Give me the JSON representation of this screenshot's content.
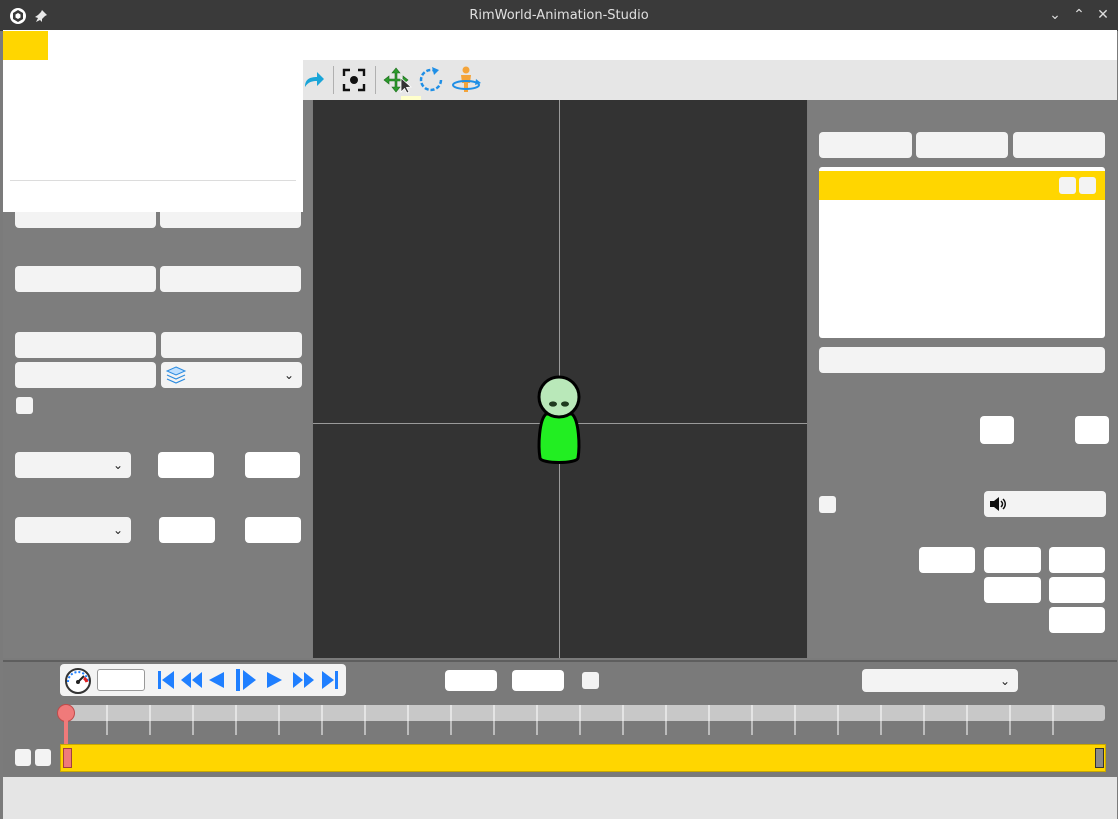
{
  "window": {
    "title": "RimWorld-Animation-Studio",
    "controls": [
      "minimize",
      "maximize",
      "close"
    ]
  },
  "toolbar": {
    "tools": [
      "redo",
      "center-view",
      "move",
      "rotate",
      "pose-rotate"
    ],
    "tooltip": ""
  },
  "left_panel": {
    "layer_dropdown_icon": "layers-icon"
  },
  "right_panel": {
    "actor_list_header": "",
    "sound_button_icon": "speaker-icon"
  },
  "playback": {
    "speed_value": "",
    "frame_dropdown_value": ""
  },
  "colors": {
    "accent": "#ffd600",
    "viewport_bg": "#333333",
    "panel_bg": "#7d7d7d",
    "pawn_body": "#22ee22",
    "pawn_head": "#b9e8b9",
    "timeline_marker": "#f07a7a",
    "transport_blue": "#1f7fff"
  }
}
